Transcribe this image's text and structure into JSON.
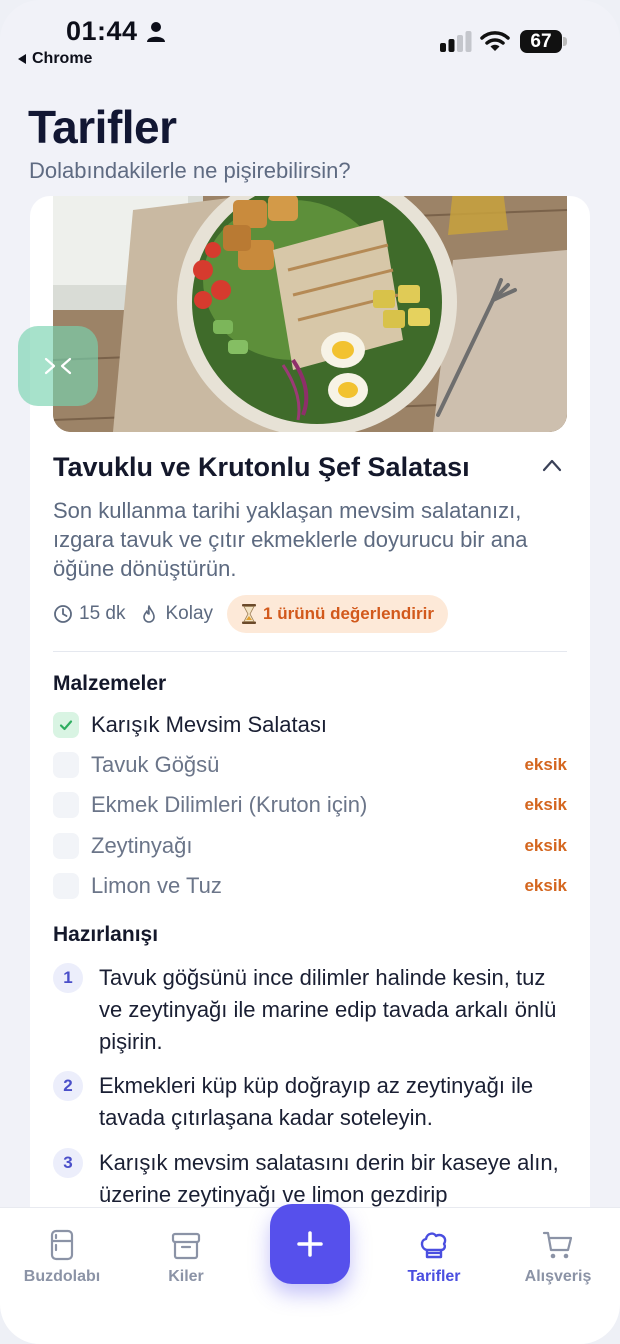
{
  "status_bar": {
    "time": "01:44",
    "back_app": "Chrome",
    "battery": "67"
  },
  "header": {
    "title": "Tarifler",
    "subtitle": "Dolabındakilerle ne pişirebilirsin?"
  },
  "recipe": {
    "title": "Tavuklu ve Krutonlu Şef Salatası",
    "description": "Son kullanma tarihi yaklaşan mevsim salatanızı, ızgara tavuk ve çıtır ekmeklerle doyurucu bir ana öğüne dönüştürün.",
    "duration": "15 dk",
    "difficulty": "Kolay",
    "badge": "1 ürünü değerlendirir",
    "ingredients_title": "Malzemeler",
    "ingredients": [
      {
        "name": "Karışık Mevsim Salatası",
        "status": ""
      },
      {
        "name": "Tavuk Göğsü",
        "status": "eksik"
      },
      {
        "name": "Ekmek Dilimleri (Kruton için)",
        "status": "eksik"
      },
      {
        "name": "Zeytinyağı",
        "status": "eksik"
      },
      {
        "name": "Limon ve Tuz",
        "status": "eksik"
      }
    ],
    "steps_title": "Hazırlanışı",
    "steps": [
      {
        "num": "1",
        "text": "Tavuk göğsünü ince dilimler halinde kesin, tuz ve zeytinyağı ile marine edip tavada arkalı önlü pişirin."
      },
      {
        "num": "2",
        "text": "Ekmekleri küp küp doğrayıp az zeytinyağı ile tavada çıtırlaşana kadar soteleyin."
      },
      {
        "num": "3",
        "text": "Karışık mevsim salatasını derin bir kaseye alın, üzerine zeytinyağı ve limon gezdirip"
      }
    ]
  },
  "nav": {
    "items": [
      {
        "label": "Buzdolabı",
        "icon": "fridge-icon"
      },
      {
        "label": "Kiler",
        "icon": "pantry-box-icon"
      },
      {
        "label": "Tarifler",
        "icon": "chef-hat-icon"
      },
      {
        "label": "Alışveriş",
        "icon": "cart-icon"
      }
    ],
    "active": "Tarifler",
    "fab_icon": "plus-icon"
  },
  "colors": {
    "accent": "#5650ec",
    "missing": "#d4661f",
    "badge_bg": "#fde9d8",
    "check": "#2fae61"
  }
}
